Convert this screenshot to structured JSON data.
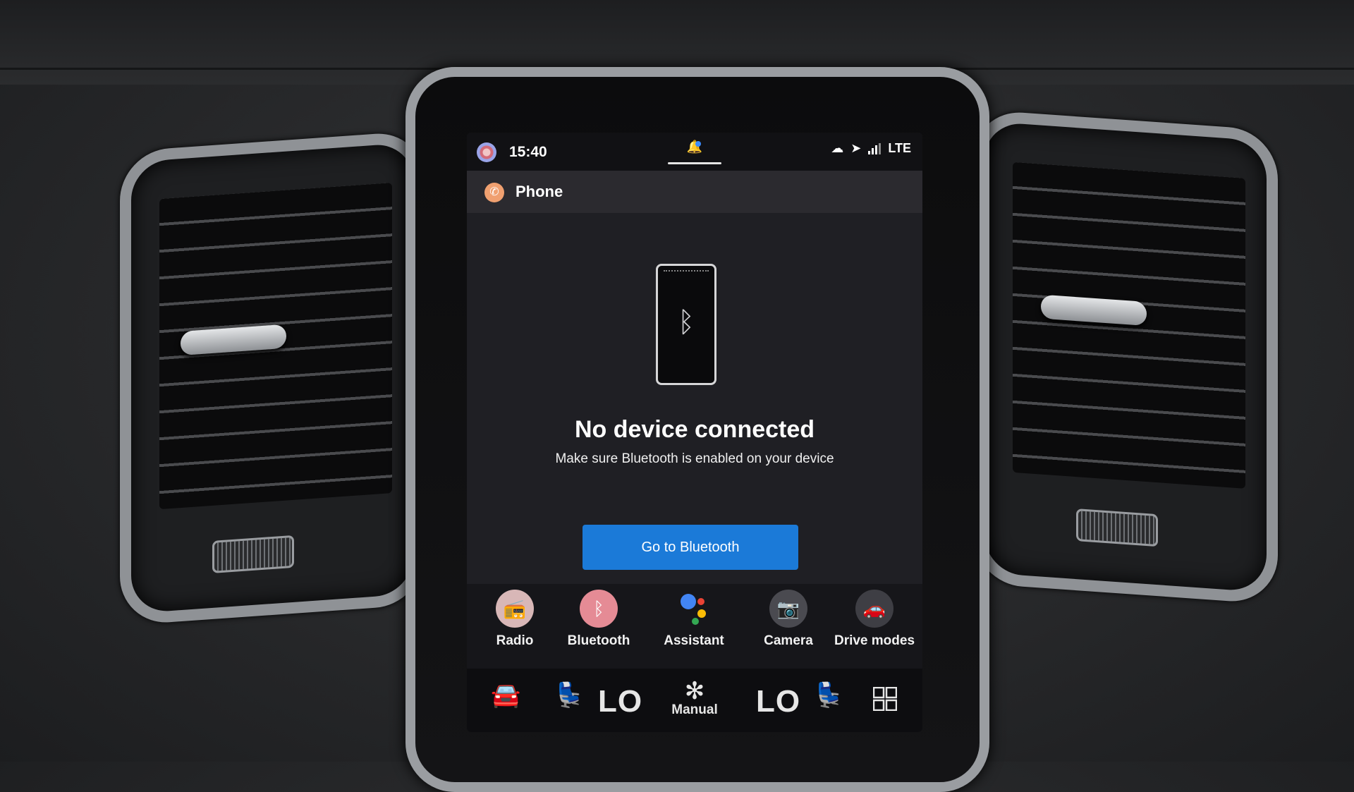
{
  "status_bar": {
    "time": "15:40",
    "network": "LTE",
    "icons": [
      "profile-icon",
      "notification-icon",
      "cloud-sync-icon",
      "navigation-icon",
      "signal-icon"
    ]
  },
  "app": {
    "title": "Phone",
    "icon": "phone-icon"
  },
  "main": {
    "illustration_icon": "bluetooth-icon",
    "headline": "No device connected",
    "message": "Make sure Bluetooth is enabled on your device",
    "button_label": "Go to Bluetooth"
  },
  "dock": {
    "items": [
      {
        "label": "Radio",
        "icon": "radio-icon"
      },
      {
        "label": "Bluetooth",
        "icon": "bluetooth-icon"
      },
      {
        "label": "Assistant",
        "icon": "assistant-icon"
      },
      {
        "label": "Camera",
        "icon": "camera-icon"
      },
      {
        "label": "Drive modes",
        "icon": "drive-modes-icon"
      }
    ]
  },
  "climate": {
    "left_temp": "LO",
    "right_temp": "LO",
    "fan_label": "Manual",
    "icons": [
      "car-icon",
      "seat-heat-left-icon",
      "fan-icon",
      "seat-heat-right-icon",
      "grid-menu-icon"
    ]
  },
  "colors": {
    "accent_button": "#1b7ad8",
    "screen_bg": "#1f1f24",
    "phone_icon": "#f0a070",
    "bluetooth_icon": "#e58b95"
  }
}
